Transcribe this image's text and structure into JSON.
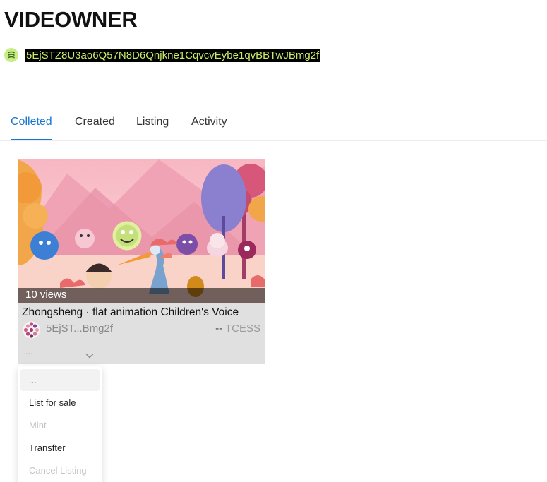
{
  "page": {
    "title": "VIDEOWNER",
    "address": "5EjSTZ8U3ao6Q57N8D6Qnjkne1CqvcvEybe1qvBBTwJBmg2f"
  },
  "tabs": [
    {
      "label": "Colleted",
      "active": true
    },
    {
      "label": "Created",
      "active": false
    },
    {
      "label": "Listing",
      "active": false
    },
    {
      "label": "Activity",
      "active": false
    }
  ],
  "card": {
    "views": "10 views",
    "title": "Zhongsheng · flat animation Children's Voice",
    "owner": "5EjST...Bmg2f",
    "price_prefix": "--",
    "price_unit": "TCESS",
    "action_value": "..."
  },
  "dropdown": {
    "items": [
      {
        "label": "...",
        "state": "selected"
      },
      {
        "label": "List for sale",
        "state": "enabled"
      },
      {
        "label": "Mint",
        "state": "disabled"
      },
      {
        "label": "Transfter",
        "state": "enabled"
      },
      {
        "label": "Cancel Listing",
        "state": "disabled"
      }
    ]
  },
  "colors": {
    "accent": "#1677d2",
    "address_text": "#c9ec6c",
    "address_bg": "#000000",
    "card_bg": "#e0e0e0"
  }
}
